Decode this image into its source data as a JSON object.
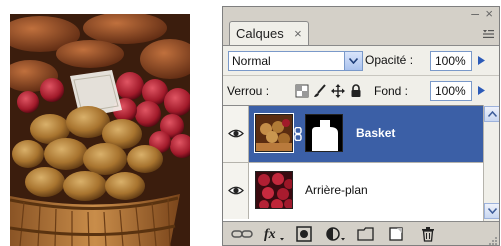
{
  "panel": {
    "tab_title": "Calques",
    "tab_close": "×",
    "window_minimize": "–",
    "window_close": "×"
  },
  "blend": {
    "mode": "Normal"
  },
  "opacity": {
    "label": "Opacité :",
    "value": "100%"
  },
  "lock": {
    "label": "Verrou :"
  },
  "fill": {
    "label": "Fond :",
    "value": "100%"
  },
  "layers": [
    {
      "name": "Basket",
      "selected": true,
      "visible": true,
      "has_mask": true
    },
    {
      "name": "Arrière-plan",
      "selected": false,
      "visible": true,
      "has_mask": false
    }
  ],
  "colors": {
    "selection": "#3b5fa6",
    "panel_bg": "#d4d0c8",
    "field_border": "#7a99c9"
  },
  "icons": [
    "link-layers-icon",
    "fx-icon",
    "add-mask-icon",
    "adjustment-layer-icon",
    "new-group-icon",
    "new-layer-icon",
    "trash-icon"
  ]
}
